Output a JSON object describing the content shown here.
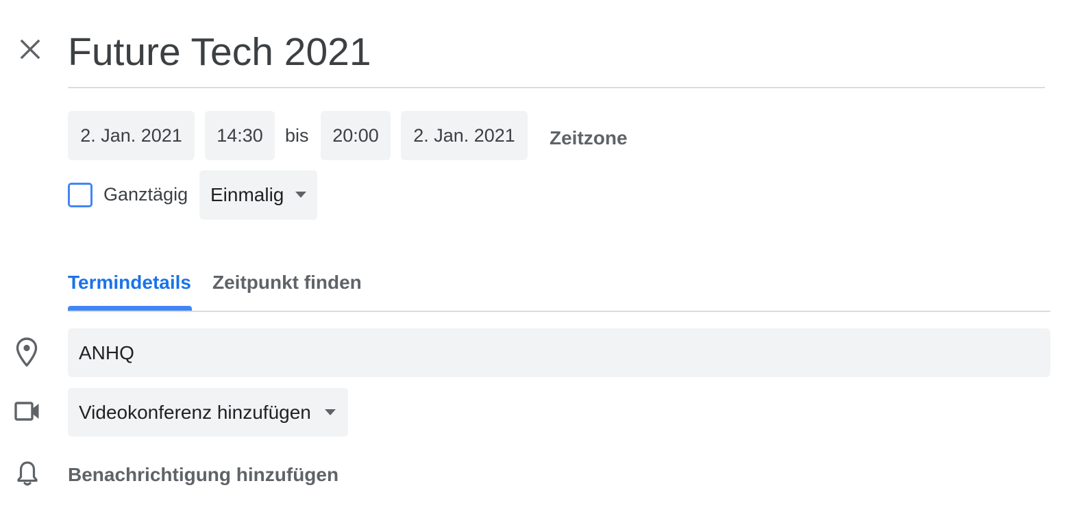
{
  "event": {
    "title": "Future Tech 2021",
    "start_date": "2. Jan. 2021",
    "start_time": "14:30",
    "separator": "bis",
    "end_time": "20:00",
    "end_date": "2. Jan. 2021",
    "timezone_label": "Zeitzone",
    "all_day_label": "Ganztägig",
    "all_day_checked": false,
    "recurrence": "Einmalig"
  },
  "tabs": [
    {
      "label": "Termindetails",
      "active": true
    },
    {
      "label": "Zeitpunkt finden",
      "active": false
    }
  ],
  "details": {
    "location_value": "ANHQ",
    "video_conference_label": "Videokonferenz hinzufügen",
    "notification_label": "Benachrichtigung hinzufügen"
  },
  "icons": {
    "close": "close-icon",
    "location": "location-pin-icon",
    "video": "video-camera-icon",
    "notification": "bell-icon",
    "caret": "dropdown-caret-icon"
  },
  "colors": {
    "accent": "#1a73e8",
    "tab_indicator": "#4285f4",
    "chip_background": "#f1f3f4",
    "text_primary": "#3c4043",
    "text_secondary": "#5f6368",
    "divider": "#dadce0"
  }
}
